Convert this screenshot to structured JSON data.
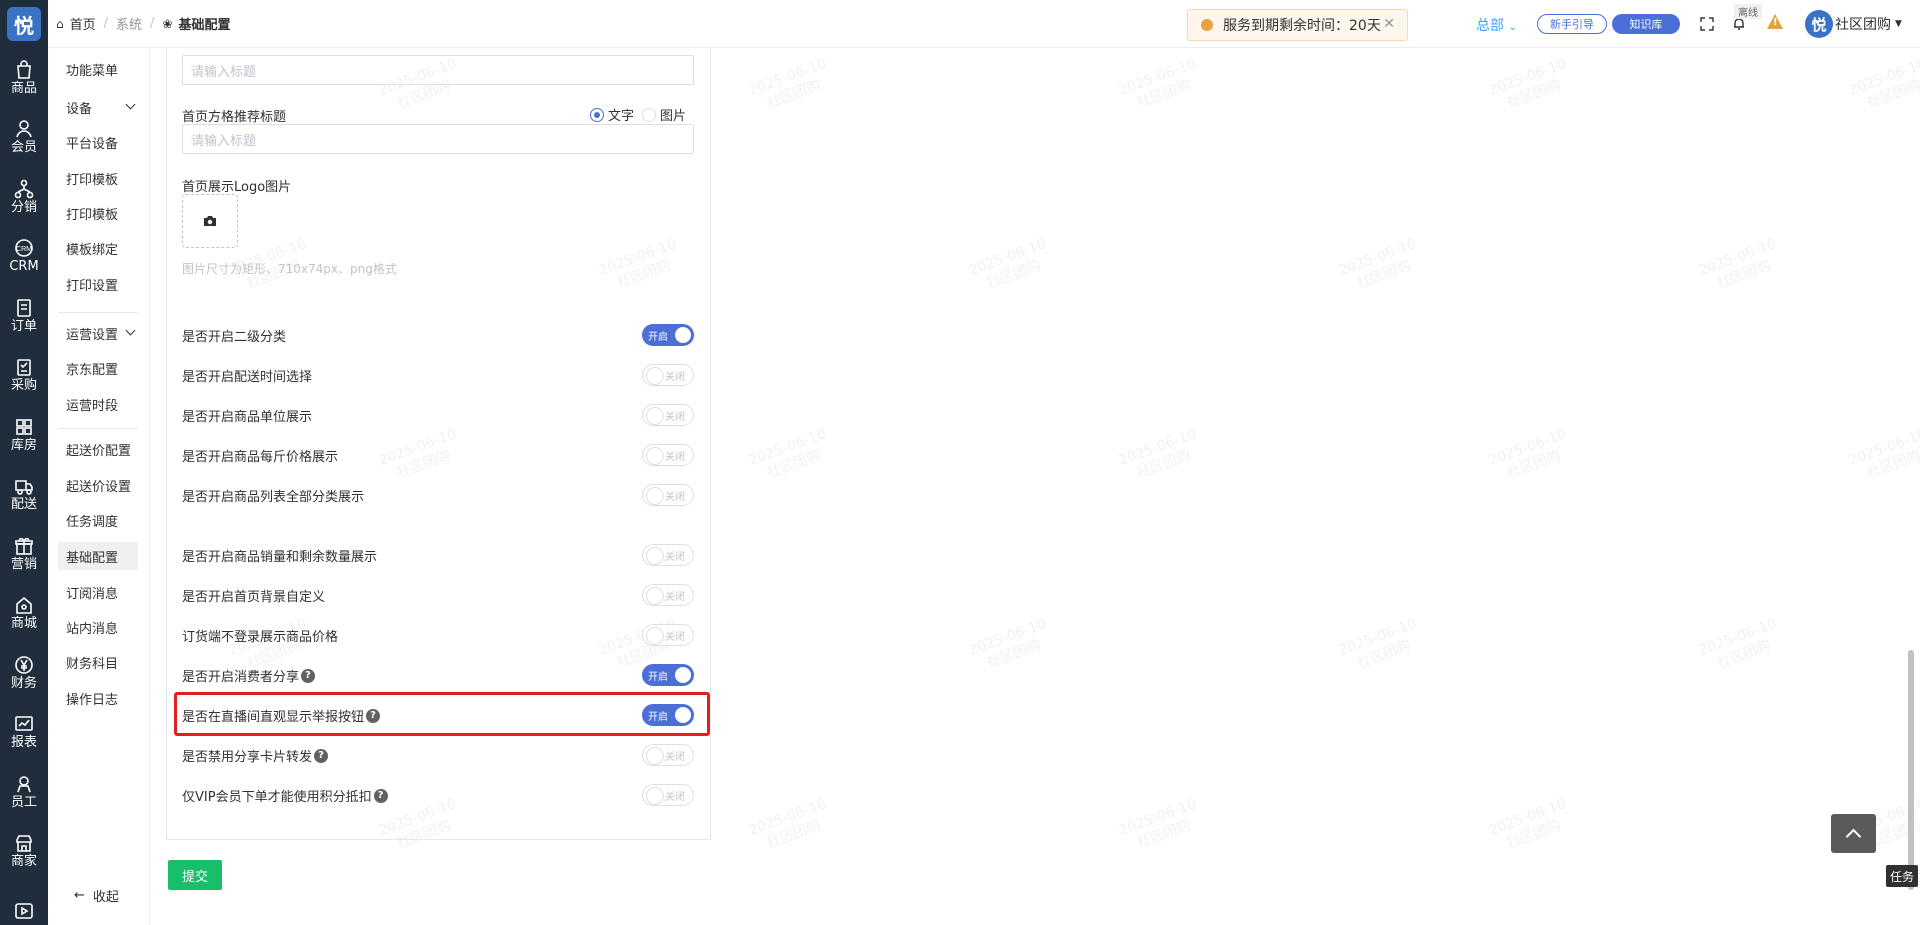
{
  "brand": {
    "logo_char": "悦"
  },
  "rail": [
    {
      "label": "商品",
      "icon": "bag-icon"
    },
    {
      "label": "会员",
      "icon": "user-icon"
    },
    {
      "label": "分销",
      "icon": "share-tree-icon"
    },
    {
      "label": "CRM",
      "icon": "crm-icon"
    },
    {
      "label": "订单",
      "icon": "order-icon"
    },
    {
      "label": "采购",
      "icon": "purchase-icon"
    },
    {
      "label": "库房",
      "icon": "warehouse-icon"
    },
    {
      "label": "配送",
      "icon": "truck-icon"
    },
    {
      "label": "营销",
      "icon": "gift-icon"
    },
    {
      "label": "商城",
      "icon": "home-store-icon"
    },
    {
      "label": "财务",
      "icon": "yen-icon"
    },
    {
      "label": "报表",
      "icon": "chart-icon"
    },
    {
      "label": "员工",
      "icon": "staff-icon"
    },
    {
      "label": "商家",
      "icon": "shop-icon"
    },
    {
      "label": "",
      "icon": "video-icon"
    }
  ],
  "breadcrumb": {
    "home": "首页",
    "mid": "系统",
    "current": "基础配置"
  },
  "notice": {
    "text": "服务到期剩余时间：20天"
  },
  "header": {
    "hq": "总部",
    "guide_btn": "新手引导",
    "kb_btn": "知识库",
    "offline": "离线",
    "user_name": "社区团购",
    "user_avatar": "悦"
  },
  "submenu": {
    "items": [
      {
        "label": "功能菜单",
        "type": "item"
      },
      {
        "label": "设备",
        "type": "group"
      },
      {
        "label": "平台设备",
        "type": "item"
      },
      {
        "label": "打印模板",
        "type": "item"
      },
      {
        "label": "打印模板",
        "type": "item"
      },
      {
        "label": "模板绑定",
        "type": "item"
      },
      {
        "label": "打印设置",
        "type": "item"
      },
      {
        "label": "运营设置",
        "type": "group"
      },
      {
        "label": "京东配置",
        "type": "item"
      },
      {
        "label": "运营时段",
        "type": "item"
      },
      {
        "label": "起送价配置",
        "type": "item"
      },
      {
        "label": "起送价设置",
        "type": "item"
      },
      {
        "label": "任务调度",
        "type": "item"
      },
      {
        "label": "基础配置",
        "type": "item",
        "active": true
      },
      {
        "label": "订阅消息",
        "type": "item"
      },
      {
        "label": "站内消息",
        "type": "item"
      },
      {
        "label": "财务科目",
        "type": "item"
      },
      {
        "label": "操作日志",
        "type": "item"
      }
    ],
    "collapse": "收起"
  },
  "form": {
    "title_placeholder_1": "请输入标题",
    "grid_title_label": "首页方格推荐标题",
    "radio_text": "文字",
    "radio_image": "图片",
    "title_placeholder_2": "请输入标题",
    "logo_label": "首页展示Logo图片",
    "logo_hint": "图片尺寸为矩形、710x74px、png格式",
    "switch_on": "开启",
    "switch_off": "关闭",
    "toggles": [
      {
        "label": "是否开启二级分类",
        "on": true,
        "help": false
      },
      {
        "label": "是否开启配送时间选择",
        "on": false,
        "help": false
      },
      {
        "label": "是否开启商品单位展示",
        "on": false,
        "help": false
      },
      {
        "label": "是否开启商品每斤价格展示",
        "on": false,
        "help": false
      },
      {
        "label": "是否开启商品列表全部分类展示",
        "on": false,
        "help": false
      },
      {
        "label": "是否开启商品销量和剩余数量展示",
        "on": false,
        "help": false
      },
      {
        "label": "是否开启首页背景自定义",
        "on": false,
        "help": false
      },
      {
        "label": "订货端不登录展示商品价格",
        "on": false,
        "help": false
      },
      {
        "label": "是否开启消费者分享",
        "on": true,
        "help": true
      },
      {
        "label": "是否在直播间直观显示举报按钮",
        "on": true,
        "help": true
      },
      {
        "label": "是否禁用分享卡片转发",
        "on": false,
        "help": true
      },
      {
        "label": "仅VIP会员下单才能使用积分抵扣",
        "on": false,
        "help": true
      }
    ],
    "submit": "提交"
  },
  "watermark": {
    "date": "2025-06-10",
    "text": "社区团购"
  },
  "task_btn": "任务"
}
